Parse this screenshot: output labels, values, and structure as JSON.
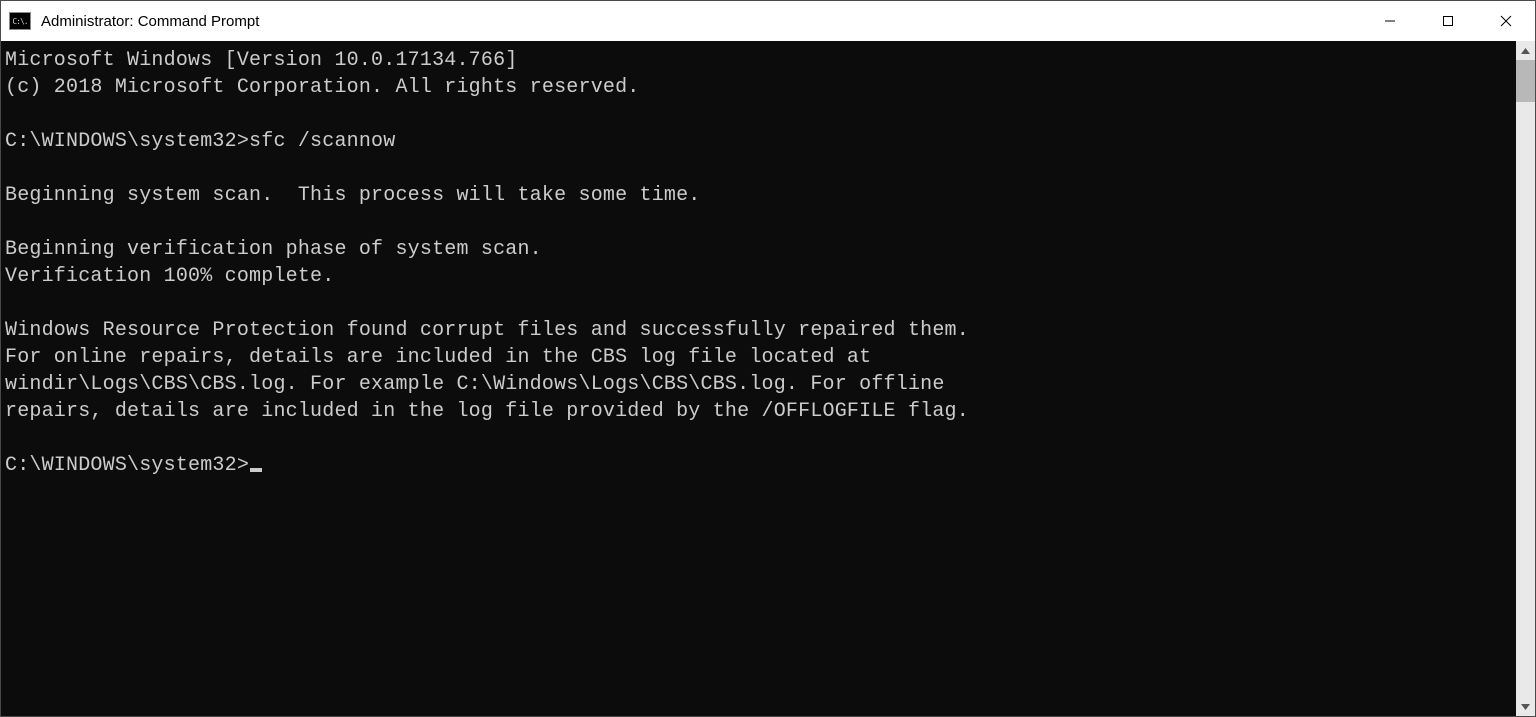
{
  "window": {
    "title": "Administrator: Command Prompt",
    "icon_text": "C:\\."
  },
  "console": {
    "lines": [
      "Microsoft Windows [Version 10.0.17134.766]",
      "(c) 2018 Microsoft Corporation. All rights reserved.",
      "",
      "C:\\WINDOWS\\system32>sfc /scannow",
      "",
      "Beginning system scan.  This process will take some time.",
      "",
      "Beginning verification phase of system scan.",
      "Verification 100% complete.",
      "",
      "Windows Resource Protection found corrupt files and successfully repaired them.",
      "For online repairs, details are included in the CBS log file located at",
      "windir\\Logs\\CBS\\CBS.log. For example C:\\Windows\\Logs\\CBS\\CBS.log. For offline",
      "repairs, details are included in the log file provided by the /OFFLOGFILE flag.",
      ""
    ],
    "current_prompt": "C:\\WINDOWS\\system32>"
  }
}
